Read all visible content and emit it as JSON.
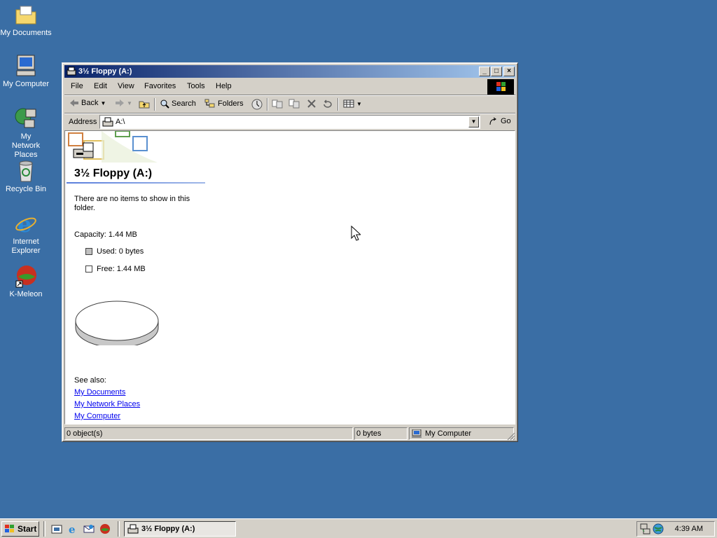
{
  "desktop": {
    "icons": [
      {
        "label": "My Documents"
      },
      {
        "label": "My Computer"
      },
      {
        "label": "My Network Places"
      },
      {
        "label": "Recycle Bin"
      },
      {
        "label": "Internet Explorer"
      },
      {
        "label": "K-Meleon"
      }
    ]
  },
  "window": {
    "title": "3½ Floppy (A:)",
    "menu": [
      "File",
      "Edit",
      "View",
      "Favorites",
      "Tools",
      "Help"
    ],
    "toolbar": {
      "back": "Back",
      "search": "Search",
      "folders": "Folders"
    },
    "address": {
      "label": "Address",
      "value": "A:\\",
      "go": "Go"
    },
    "content": {
      "folder_title": "3½ Floppy (A:)",
      "empty_message": "There are no items to show in this folder.",
      "capacity": "Capacity: 1.44 MB",
      "used": "Used: 0 bytes",
      "free": "Free: 1.44 MB",
      "used_fraction": 0,
      "see_also": "See also:",
      "links": [
        "My Documents",
        "My Network Places",
        "My Computer"
      ]
    },
    "status": {
      "objects": "0 object(s)",
      "size": "0 bytes",
      "zone": "My Computer"
    }
  },
  "taskbar": {
    "start": "Start",
    "task": "3½ Floppy (A:)",
    "clock": "4:39 AM"
  },
  "colors": {
    "desktop": "#3a6ea5",
    "title_start": "#0a246a",
    "title_end": "#a6caf0",
    "link": "#0000ee"
  }
}
